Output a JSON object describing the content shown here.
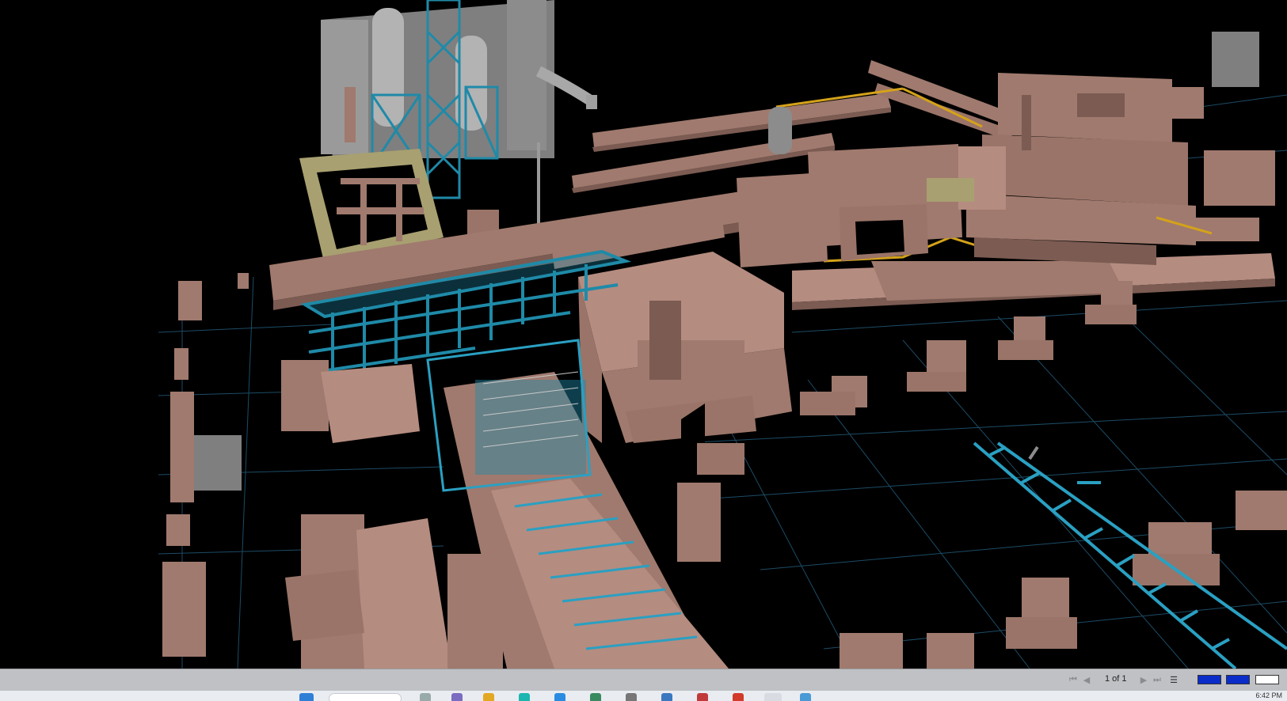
{
  "viewer": {
    "page_indicator": "1 of 1",
    "clock": "6:42 PM"
  },
  "colors": {
    "background": "#000000",
    "concrete": "#a07a6e",
    "concrete_light": "#b58c80",
    "concrete_dark": "#7b5b52",
    "steel": "#1f8aa8",
    "steel_light": "#2aa0c2",
    "equipment": "#8c8c8c",
    "walkway": "#a8a070",
    "pipe_yellow": "#d4a21a",
    "grid": "#1c4c66",
    "statusbar": "#bfc1c4",
    "taskbar": "#e9ecf1"
  },
  "icons": [
    "first-page-icon",
    "prev-page-icon",
    "next-page-icon",
    "last-page-icon",
    "list-view-icon",
    "measure-tool-icon",
    "layer-tool-icon",
    "section-tool-icon"
  ]
}
